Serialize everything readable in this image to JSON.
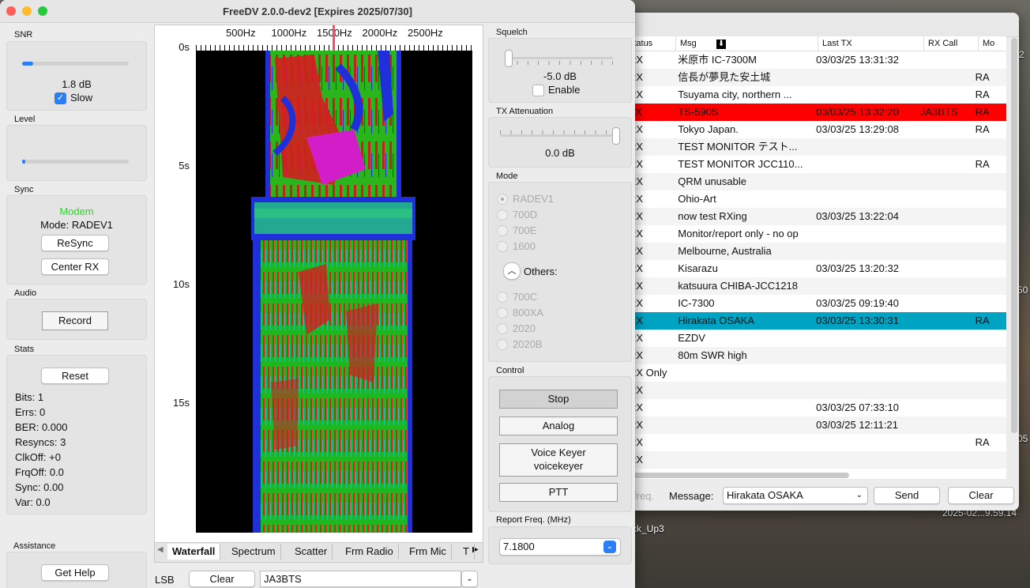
{
  "desktop": {
    "label_1": "ck_Up3",
    "label_2": "2025-02...9.59.14",
    "edge_a": "2",
    "edge_b": "50",
    "edge_c": "05"
  },
  "station_list": {
    "columns": [
      "Status",
      "Msg",
      "Last TX",
      "RX Call",
      "Mo"
    ],
    "rows": [
      {
        "status": "RX",
        "msg": "米原市 IC-7300M",
        "last_tx": "03/03/25 13:31:32",
        "rx_call": "",
        "mode": ""
      },
      {
        "status": "RX",
        "msg": "信長が夢見た安土城",
        "last_tx": "",
        "rx_call": "",
        "mode": "RA"
      },
      {
        "status": "RX",
        "msg": "Tsuyama city, northern ...",
        "last_tx": "",
        "rx_call": "",
        "mode": "RA"
      },
      {
        "status": "TX",
        "msg": "TS-590S",
        "last_tx": "03/03/25 13:32:20",
        "rx_call": "JA3BTS",
        "mode": "RA",
        "highlight": "red"
      },
      {
        "status": "RX",
        "msg": "Tokyo Japan.",
        "last_tx": "03/03/25 13:29:08",
        "rx_call": "",
        "mode": "RA"
      },
      {
        "status": "RX",
        "msg": "TEST MONITOR  テスト...",
        "last_tx": "",
        "rx_call": "",
        "mode": ""
      },
      {
        "status": "RX",
        "msg": "TEST MONITOR  JCC110...",
        "last_tx": "",
        "rx_call": "",
        "mode": "RA"
      },
      {
        "status": "RX",
        "msg": "QRM unusable",
        "last_tx": "",
        "rx_call": "",
        "mode": ""
      },
      {
        "status": "RX",
        "msg": "Ohio-Art",
        "last_tx": "",
        "rx_call": "",
        "mode": ""
      },
      {
        "status": "RX",
        "msg": "now test RXing",
        "last_tx": "03/03/25 13:22:04",
        "rx_call": "",
        "mode": ""
      },
      {
        "status": "RX",
        "msg": "Monitor/report only - no op",
        "last_tx": "",
        "rx_call": "",
        "mode": ""
      },
      {
        "status": "RX",
        "msg": "Melbourne, Australia",
        "last_tx": "",
        "rx_call": "",
        "mode": ""
      },
      {
        "status": "RX",
        "msg": "Kisarazu",
        "last_tx": "03/03/25 13:20:32",
        "rx_call": "",
        "mode": ""
      },
      {
        "status": "RX",
        "msg": "katsuura CHIBA-JCC1218",
        "last_tx": "",
        "rx_call": "",
        "mode": ""
      },
      {
        "status": "RX",
        "msg": "IC-7300",
        "last_tx": "03/03/25 09:19:40",
        "rx_call": "",
        "mode": ""
      },
      {
        "status": "RX",
        "msg": "Hirakata OSAKA",
        "last_tx": "03/03/25 13:30:31",
        "rx_call": "",
        "mode": "RA",
        "highlight": "teal"
      },
      {
        "status": "RX",
        "msg": "EZDV",
        "last_tx": "",
        "rx_call": "",
        "mode": ""
      },
      {
        "status": "RX",
        "msg": "80m SWR high",
        "last_tx": "",
        "rx_call": "",
        "mode": ""
      },
      {
        "status": "RX Only",
        "msg": "",
        "last_tx": "",
        "rx_call": "",
        "mode": ""
      },
      {
        "status": "RX",
        "msg": "",
        "last_tx": "",
        "rx_call": "",
        "mode": ""
      },
      {
        "status": "RX",
        "msg": "",
        "last_tx": "03/03/25 07:33:10",
        "rx_call": "",
        "mode": ""
      },
      {
        "status": "RX",
        "msg": "",
        "last_tx": "03/03/25 12:11:21",
        "rx_call": "",
        "mode": ""
      },
      {
        "status": "RX",
        "msg": "",
        "last_tx": "",
        "rx_call": "",
        "mode": "RA"
      },
      {
        "status": "RX",
        "msg": "",
        "last_tx": "",
        "rx_call": "",
        "mode": ""
      }
    ],
    "bottom": {
      "freq_label": "freq.",
      "message_label": "Message:",
      "message_value": "Hirakata OSAKA",
      "send_label": "Send",
      "clear_label": "Clear"
    }
  },
  "main": {
    "title": "FreeDV 2.0.0-dev2 [Expires 2025/07/30]",
    "snr": {
      "label": "SNR",
      "value": "1.8 dB",
      "slow_label": "Slow",
      "level": 0.1
    },
    "level": {
      "label": "Level",
      "level": 0.03
    },
    "sync": {
      "label": "Sync",
      "status": "Modem",
      "mode_text": "Mode: RADEV1",
      "resync_label": "ReSync",
      "center_label": "Center RX"
    },
    "audio": {
      "label": "Audio",
      "record_label": "Record"
    },
    "stats": {
      "label": "Stats",
      "reset_label": "Reset",
      "lines": [
        "Bits: 1",
        "Errs: 0",
        "BER: 0.000",
        "Resyncs: 3",
        "ClkOff: +0",
        "FrqOff: 0.0",
        "Sync: 0.00",
        "Var:  0.0"
      ]
    },
    "assistance": {
      "label": "Assistance",
      "help_label": "Get Help"
    },
    "waterfall": {
      "freq_ticks": [
        "500Hz",
        "1000Hz",
        "1500Hz",
        "2000Hz",
        "2500Hz"
      ],
      "time_ticks": [
        "0s",
        "5s",
        "10s",
        "15s"
      ]
    },
    "tabs": [
      "Waterfall",
      "Spectrum",
      "Scatter",
      "Frm Radio",
      "Frm Mic",
      "T"
    ],
    "bottom_bar": {
      "sideband": "LSB",
      "clear_label": "Clear",
      "callsign": "JA3BTS"
    },
    "squelch": {
      "label": "Squelch",
      "value": "-5.0 dB",
      "enable_label": "Enable"
    },
    "tx_atten": {
      "label": "TX Attenuation",
      "value": "0.0 dB"
    },
    "mode": {
      "label": "Mode",
      "options": [
        "RADEV1",
        "700D",
        "700E",
        "1600"
      ],
      "others_label": "Others:",
      "other_options": [
        "700C",
        "800XA",
        "2020",
        "2020B"
      ]
    },
    "control": {
      "label": "Control",
      "stop_label": "Stop",
      "analog_label": "Analog",
      "voice_keyer_line1": "Voice Keyer",
      "voice_keyer_line2": "voicekeyer",
      "ptt_label": "PTT"
    },
    "report_freq": {
      "label": "Report Freq. (MHz)",
      "value": "7.1800"
    }
  }
}
